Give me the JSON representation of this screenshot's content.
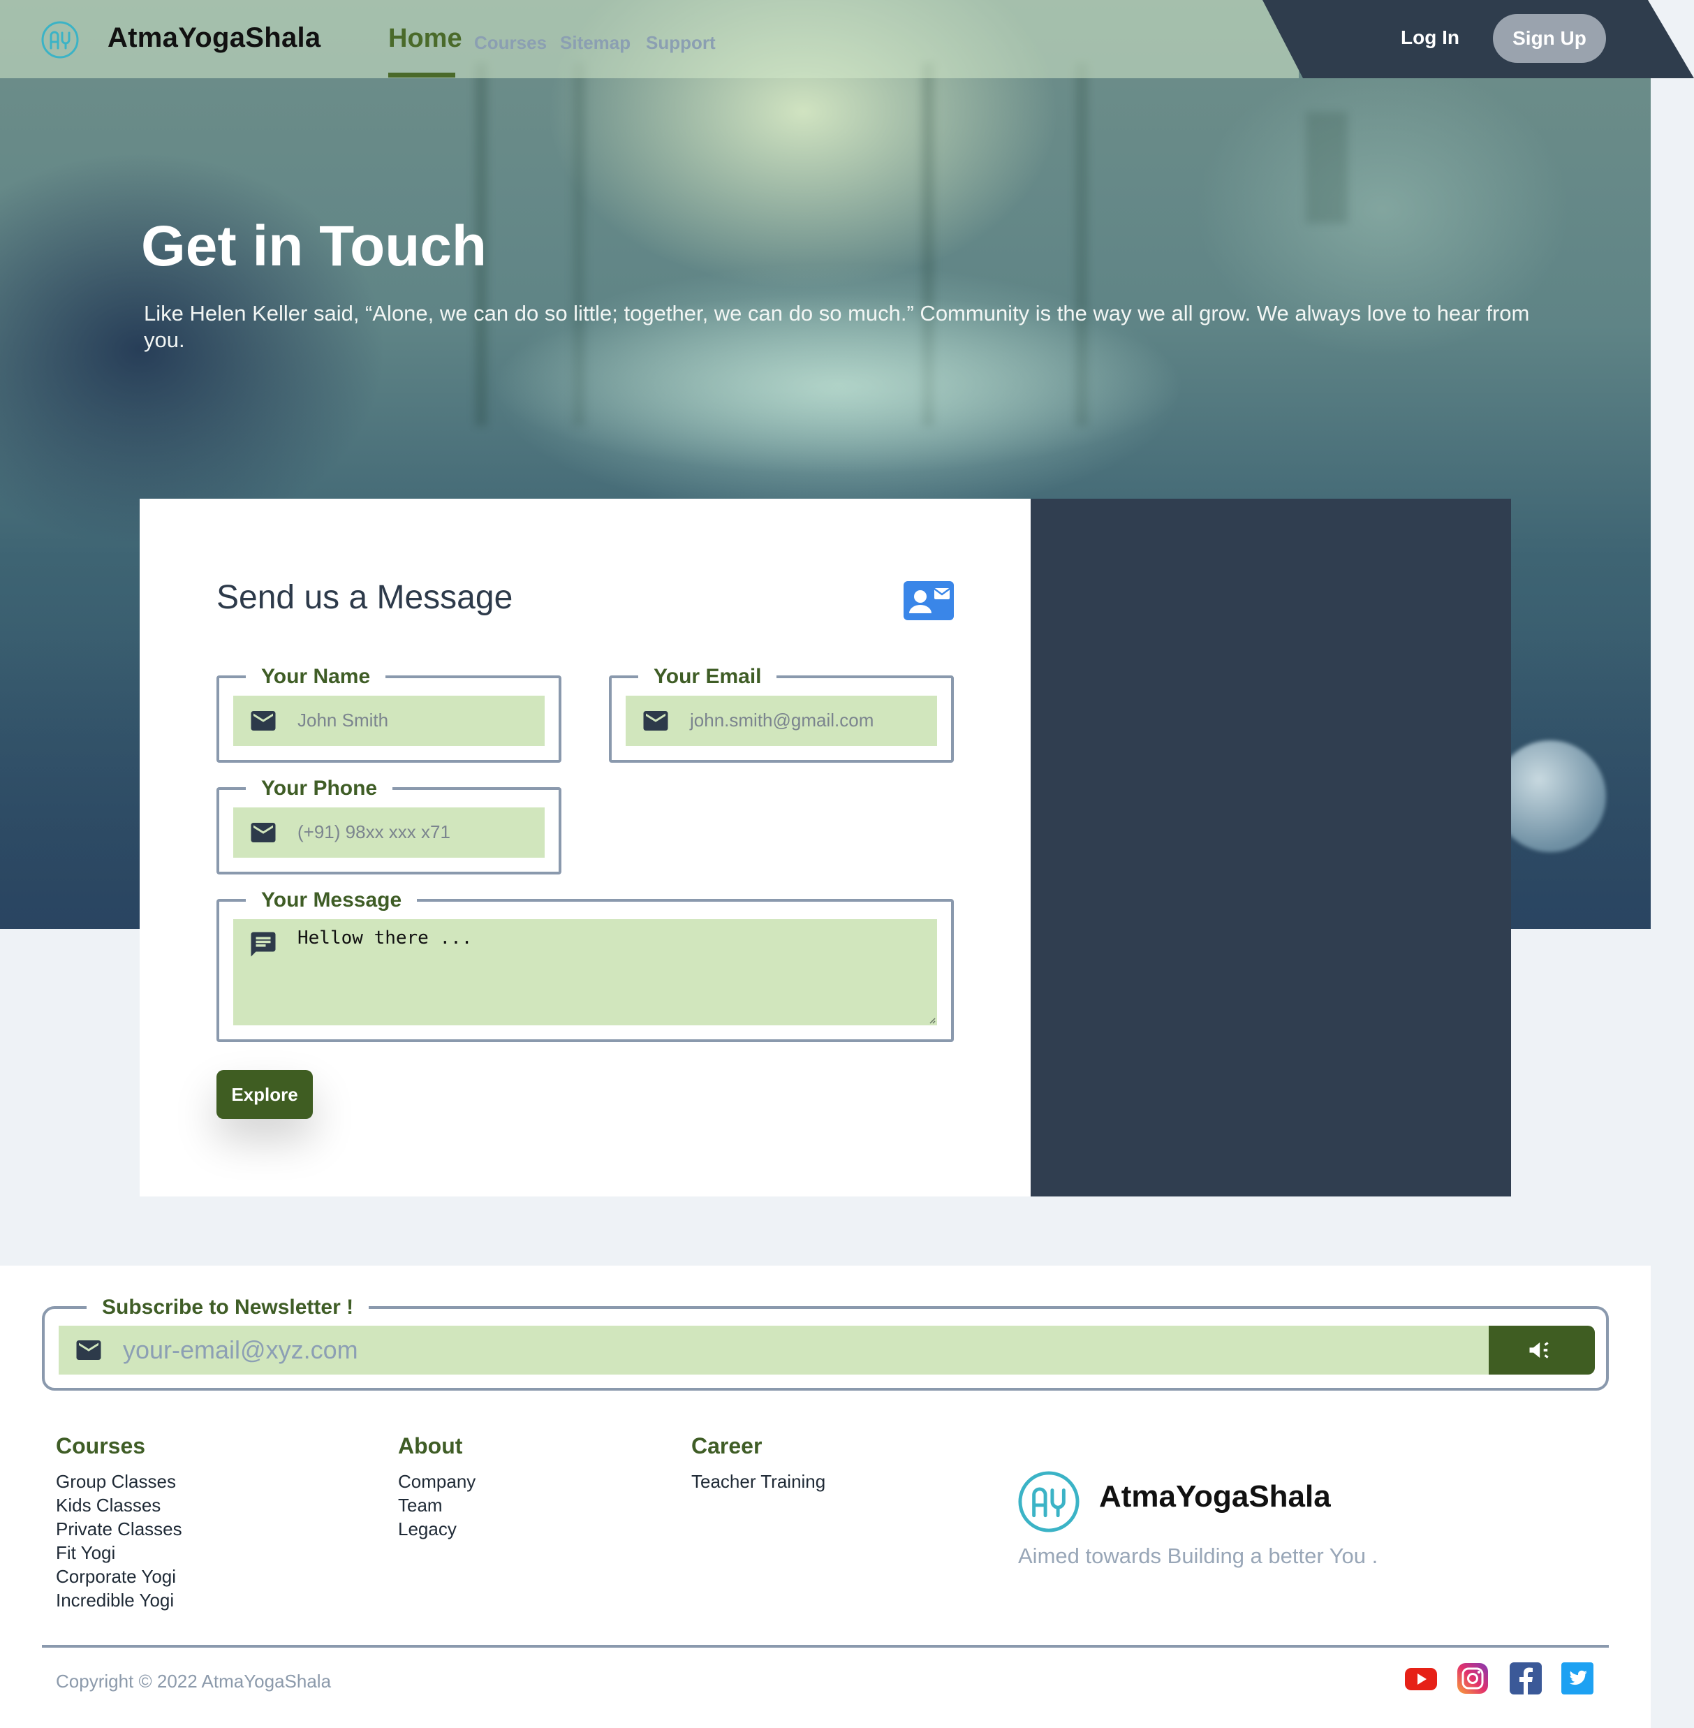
{
  "nav": {
    "brand": "AtmaYogaShala",
    "logo_icon": "ay-logo-icon",
    "links": [
      {
        "label": "Home",
        "active": true
      },
      {
        "label": "Courses",
        "active": false
      },
      {
        "label": "Sitemap",
        "active": false
      },
      {
        "label": "Support",
        "active": false
      }
    ],
    "login": "Log In",
    "signup": "Sign Up"
  },
  "hero": {
    "title": "Get in Touch",
    "text": "Like Helen Keller said, “Alone, we can do so little; together, we can do so much.” Community is the way we all grow. We always love to hear from you."
  },
  "form": {
    "title": "Send us a Message",
    "title_icon": "contact-card-icon",
    "fields": {
      "name": {
        "label": "Your Name",
        "placeholder": "John Smith",
        "icon": "mail-icon"
      },
      "email": {
        "label": "Your Email",
        "placeholder": "john.smith@gmail.com",
        "icon": "mail-icon"
      },
      "phone": {
        "label": "Your Phone",
        "placeholder": "(+91) 98xx xxx x71",
        "icon": "mail-icon"
      },
      "message": {
        "label": "Your Message",
        "value": "Hellow there ...",
        "icon": "chat-icon"
      }
    },
    "submit": "Explore"
  },
  "newsletter": {
    "label": "Subscribe to Newsletter !",
    "placeholder": "your-email@xyz.com",
    "button_icon": "megaphone-icon"
  },
  "footer": {
    "columns": [
      {
        "title": "Courses",
        "items": [
          "Group Classes",
          "Kids Classes",
          "Private Classes",
          "Fit Yogi",
          "Corporate Yogi",
          "Incredible Yogi"
        ]
      },
      {
        "title": "About",
        "items": [
          "Company",
          "Team",
          "Legacy"
        ]
      },
      {
        "title": "Career",
        "items": [
          "Teacher Training"
        ]
      }
    ],
    "brand": "AtmaYogaShala",
    "tagline": "Aimed towards Building a better You .",
    "copyright": "Copyright © 2022 AtmaYogaShala",
    "social": [
      "youtube-icon",
      "instagram-icon",
      "facebook-icon",
      "twitter-icon"
    ]
  },
  "colors": {
    "accent_green": "#3f5d22",
    "field_bg": "#d1e6bd",
    "dark_panel": "#303e50",
    "logo_teal": "#3bb3c6"
  }
}
